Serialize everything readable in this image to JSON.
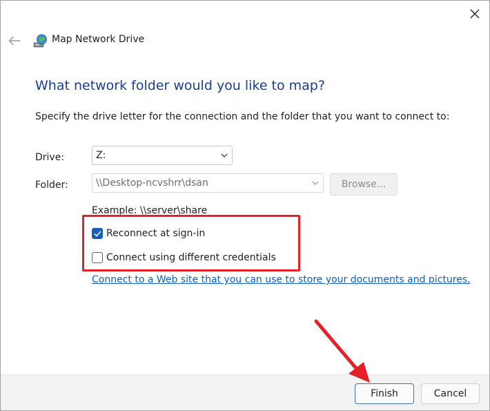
{
  "window": {
    "title": "Map Network Drive",
    "icons": {
      "close": "close-icon",
      "back": "back-arrow-icon",
      "app": "network-drive-icon"
    }
  },
  "main": {
    "heading": "What network folder would you like to map?",
    "instruction": "Specify the drive letter for the connection and the folder that you want to connect to:",
    "drive": {
      "label": "Drive:",
      "value": "Z:"
    },
    "folder": {
      "label": "Folder:",
      "value": "\\\\Desktop-ncvshrr\\dsan",
      "browse_label": "Browse..."
    },
    "example": "Example: \\\\server\\share",
    "options": [
      {
        "label": "Reconnect at sign-in",
        "checked": true
      },
      {
        "label": "Connect using different credentials",
        "checked": false
      }
    ],
    "link": {
      "text": "Connect to a Web site that you can use to store your documents and pictures",
      "suffix": "."
    }
  },
  "footer": {
    "finish_label": "Finish",
    "cancel_label": "Cancel"
  },
  "colors": {
    "heading": "#1a3d8f",
    "accent": "#1b5fb4",
    "link": "#0f5fbf",
    "annotation": "#e52027"
  }
}
